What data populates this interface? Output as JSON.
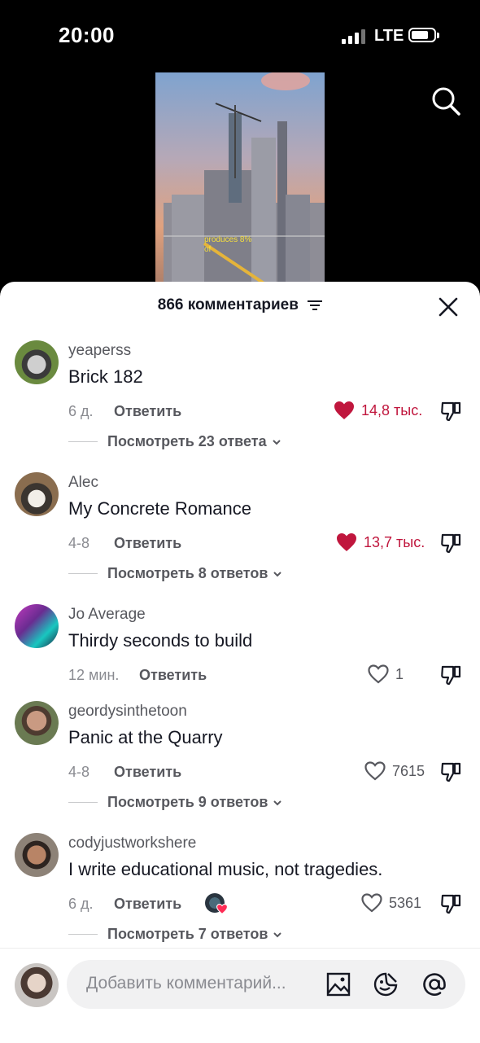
{
  "status_bar": {
    "time": "20:00",
    "network": "LTE"
  },
  "video": {
    "caption_line1": "produces 8%",
    "caption_line2": "of"
  },
  "sheet": {
    "title": "866 комментариев"
  },
  "comments": [
    {
      "username": "yeaperss",
      "text": "Brick 182",
      "age": "6 д.",
      "reply": "Ответить",
      "likes": "14,8 тыс.",
      "liked": true,
      "view_replies": "Посмотреть 23 ответа"
    },
    {
      "username": "Alec",
      "text": "My Concrete Romance",
      "age": "4-8",
      "reply": "Ответить",
      "likes": "13,7 тыс.",
      "liked": true,
      "view_replies": "Посмотреть 8 ответов"
    },
    {
      "username": "Jo Average",
      "text": "Thirdy seconds to build",
      "age": "12 мин.",
      "reply": "Ответить",
      "likes": "1",
      "liked": false
    },
    {
      "username": "geordysinthetoon",
      "text": "Panic at the Quarry",
      "age": "4-8",
      "reply": "Ответить",
      "likes": "7615",
      "liked": false,
      "view_replies": "Посмотреть 9 ответов"
    },
    {
      "username": "codyjustworkshere",
      "text": "I write educational music, not tragedies.",
      "age": "6 д.",
      "reply": "Ответить",
      "likes": "5361",
      "liked": false,
      "view_replies": "Посмотреть 7 ответов"
    }
  ],
  "input_bar": {
    "placeholder": "Добавить комментарий..."
  },
  "colors": {
    "liked": "#c0163d",
    "text": "#161823",
    "muted": "#8a8b91"
  },
  "icons": [
    "search-icon",
    "filter-icon",
    "close-icon",
    "heart-icon",
    "dislike-icon",
    "chevron-down-icon",
    "image-icon",
    "emoji-icon",
    "mention-icon"
  ]
}
